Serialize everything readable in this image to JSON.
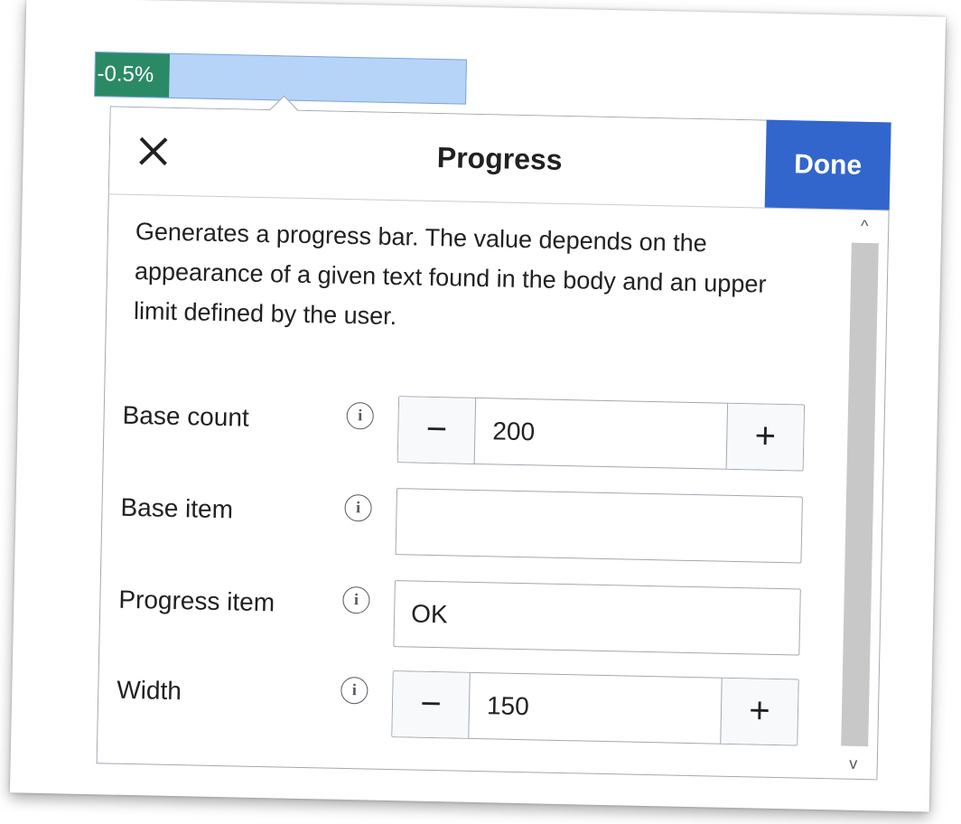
{
  "widget": {
    "progress_text": "-0.5%",
    "fill_fraction": 0.2
  },
  "dialog": {
    "title": "Progress",
    "done_label": "Done",
    "description": "Generates a progress bar. The value depends on the appearance of a given text found in the body and an upper limit defined by the user.",
    "fields": {
      "base_count": {
        "label": "Base count",
        "value": "200",
        "minus": "−",
        "plus": "+"
      },
      "base_item": {
        "label": "Base item",
        "value": ""
      },
      "progress_item": {
        "label": "Progress item",
        "value": "OK"
      },
      "width": {
        "label": "Width",
        "value": "150",
        "minus": "−",
        "plus": "+"
      }
    },
    "info_glyph": "i",
    "scroll_up": "^",
    "scroll_down": "v"
  },
  "colors": {
    "accent": "#3366cc",
    "progress_fill": "#2b8a66",
    "progress_bg": "#b6d3f8"
  }
}
